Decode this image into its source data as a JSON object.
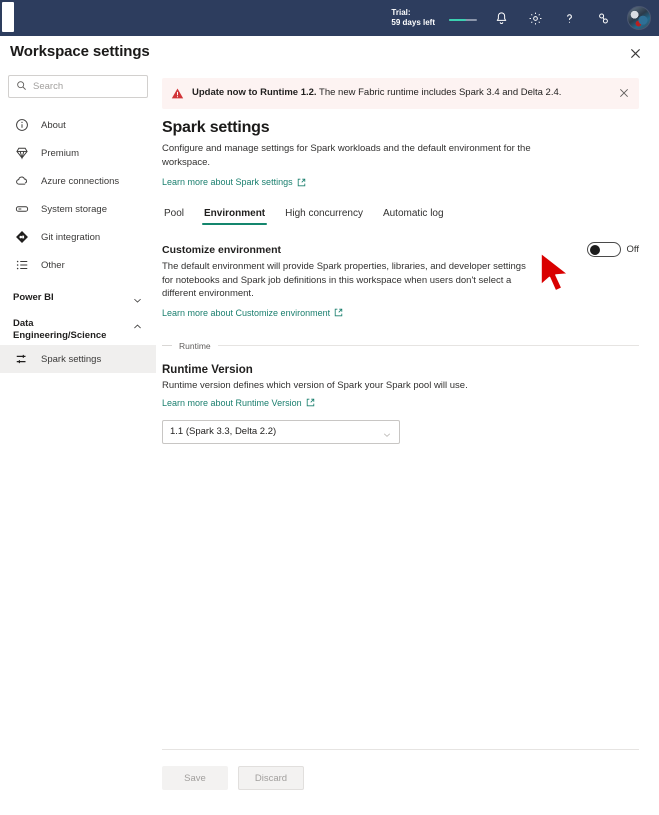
{
  "topbar": {
    "trial_label": "Trial:",
    "trial_days": "59 days left",
    "icons": [
      {
        "name": "bell-icon",
        "label": "Notifications"
      },
      {
        "name": "gear-icon",
        "label": "Settings"
      },
      {
        "name": "help-icon",
        "label": "Help"
      },
      {
        "name": "connections-icon",
        "label": "Connections"
      }
    ],
    "avatar_name": "User avatar",
    "background_color": "#2d3d5e"
  },
  "header": {
    "title": "Workspace settings",
    "close_label": "Close"
  },
  "sidebar": {
    "search": {
      "placeholder": "Search",
      "value": ""
    },
    "items": [
      {
        "label": "About",
        "icon": "info-circle-icon"
      },
      {
        "label": "Premium",
        "icon": "diamond-icon"
      },
      {
        "label": "Azure connections",
        "icon": "cloud-icon"
      },
      {
        "label": "System storage",
        "icon": "storage-icon"
      },
      {
        "label": "Git integration",
        "icon": "git-icon"
      },
      {
        "label": "Other",
        "icon": "list-icon"
      }
    ],
    "groups": [
      {
        "title": "Power BI",
        "expanded": false,
        "chevron": "chevron-down-icon",
        "children": []
      },
      {
        "title": "Data Engineering/Science",
        "expanded": true,
        "chevron": "chevron-up-icon",
        "children": [
          {
            "label": "Spark settings",
            "icon": "sliders-icon",
            "active": true
          }
        ]
      }
    ]
  },
  "banner": {
    "icon": "warning-triangle-icon",
    "bold_text": "Update now to Runtime 1.2.",
    "text": " The new Fabric runtime includes Spark 3.4 and Delta 2.4.",
    "close_label": "Dismiss",
    "background_color": "#fdf3f2",
    "icon_color": "#d13438"
  },
  "main": {
    "title": "Spark settings",
    "description": "Configure and manage settings for Spark workloads and the default environment for the workspace.",
    "learn_more": "Learn more about Spark settings",
    "tabs": [
      {
        "label": "Pool",
        "active": false
      },
      {
        "label": "Environment",
        "active": true
      },
      {
        "label": "High concurrency",
        "active": false
      },
      {
        "label": "Automatic log",
        "active": false
      }
    ],
    "active_tab_color": "#14866d",
    "customize": {
      "title": "Customize environment",
      "description": "The default environment will provide Spark properties, libraries, and developer settings for notebooks and Spark job definitions in this workspace when users don't select a different environment.",
      "learn_more": "Learn more about Customize environment",
      "toggle_state": "Off"
    },
    "runtime_legend": "Runtime",
    "runtime": {
      "title": "Runtime Version",
      "description": "Runtime version defines which version of Spark your Spark pool will use.",
      "learn_more": "Learn more about Runtime Version",
      "selected": "1.1 (Spark 3.3, Delta 2.2)"
    },
    "footer": {
      "save_label": "Save",
      "discard_label": "Discard"
    }
  },
  "cursor": {
    "name": "mouse-pointer",
    "color": "#d90000"
  }
}
